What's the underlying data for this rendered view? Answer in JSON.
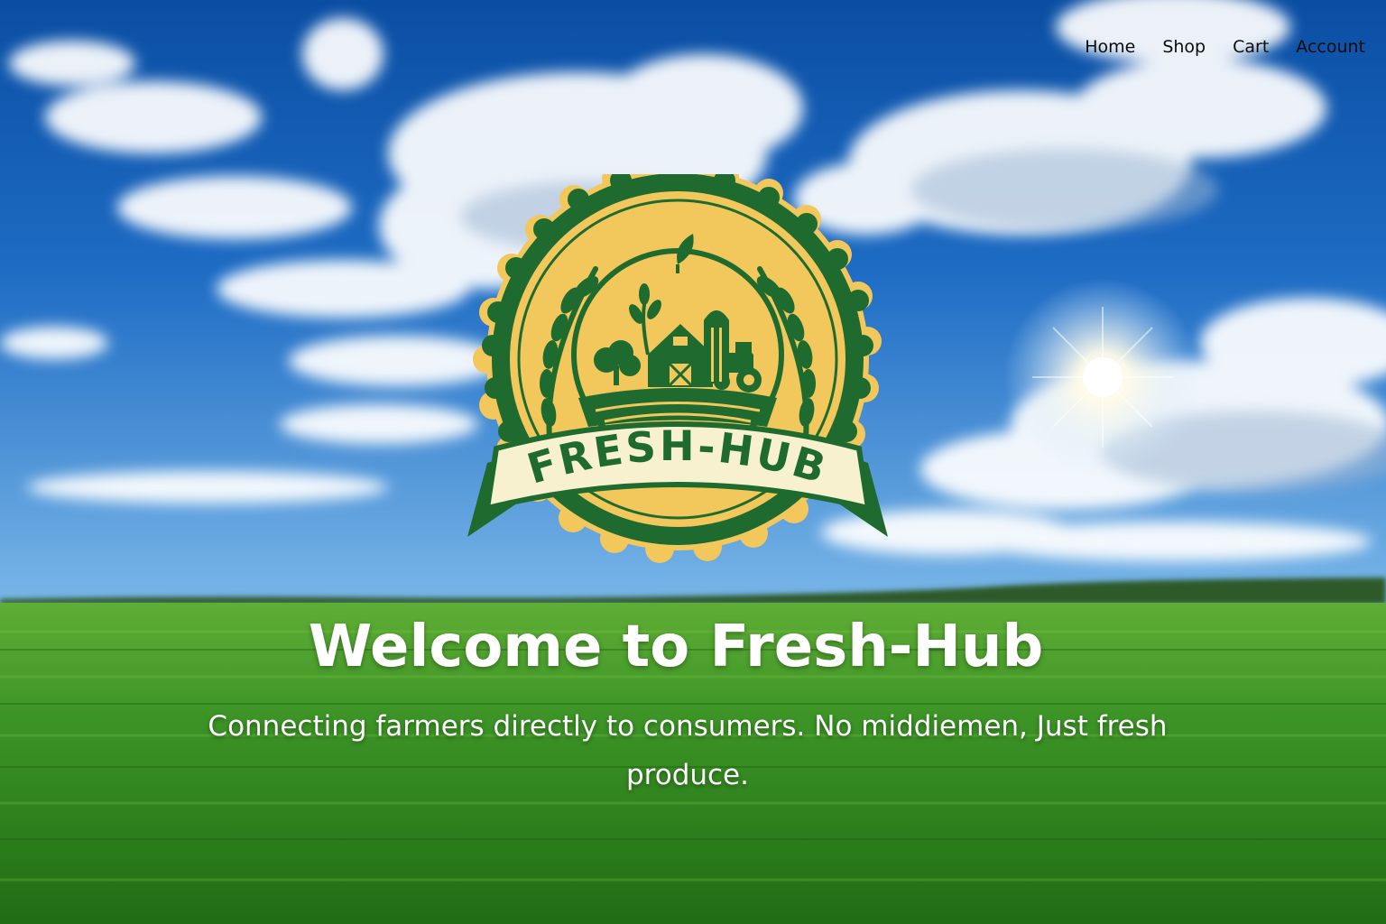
{
  "nav": {
    "items": [
      {
        "label": "Home"
      },
      {
        "label": "Shop"
      },
      {
        "label": "Cart"
      },
      {
        "label": "Account"
      }
    ]
  },
  "logo": {
    "text": "FRESH-HUB",
    "colors": {
      "ring": "#1f6b2f",
      "gold": "#f2c75c",
      "ribbon": "#f7f1cf"
    }
  },
  "hero": {
    "headline": "Welcome to Fresh-Hub",
    "tagline": "Connecting farmers directly to consumers. No middiemen, Just fresh produce."
  },
  "colors": {
    "sky_top": "#0d52a8",
    "sky_horizon": "#6fb0e6",
    "field": "#2f8a1f",
    "nav_text": "#0b0b0b",
    "hero_text": "#ffffff"
  }
}
